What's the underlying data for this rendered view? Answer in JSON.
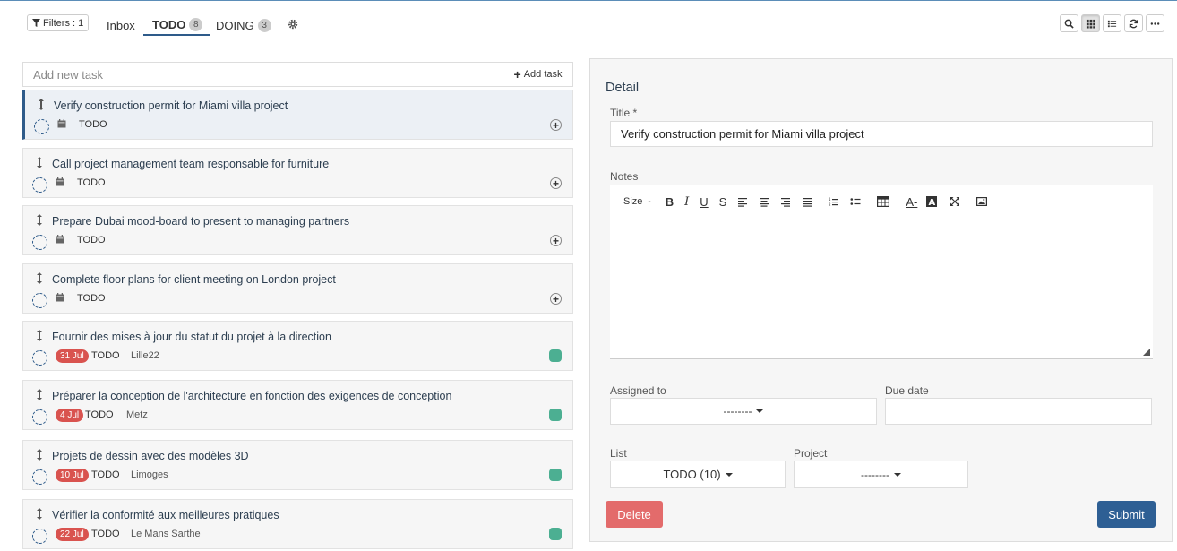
{
  "toolbar": {
    "filter_label": "Filters : 1",
    "tabs": [
      {
        "label": "Inbox",
        "count": null
      },
      {
        "label": "TODO",
        "count": "8"
      },
      {
        "label": "DOING",
        "count": "3"
      }
    ]
  },
  "add_task": {
    "placeholder": "Add new task",
    "button_label": "Add task"
  },
  "tasks": [
    {
      "title": "Verify construction permit for Miami villa project",
      "status": "TODO",
      "date": "",
      "location": ""
    },
    {
      "title": "Call project management team responsable for furniture",
      "status": "TODO",
      "date": "",
      "location": ""
    },
    {
      "title": "Prepare Dubai mood-board to present to managing partners",
      "status": "TODO",
      "date": "",
      "location": ""
    },
    {
      "title": "Complete floor plans for client meeting on London project",
      "status": "TODO",
      "date": "",
      "location": ""
    },
    {
      "title": "Fournir des mises à jour du statut du projet à la direction",
      "status": "TODO",
      "date": "31 Jul",
      "location": "Lille22"
    },
    {
      "title": "Préparer la conception de l'architecture en fonction des exigences de conception",
      "status": "TODO",
      "date": "4 Jul",
      "location": "Metz"
    },
    {
      "title": "Projets de dessin avec des modèles 3D",
      "status": "TODO",
      "date": "10 Jul",
      "location": "Limoges"
    },
    {
      "title": "Vérifier la conformité aux meilleures pratiques",
      "status": "TODO",
      "date": "22 Jul",
      "location": "Le Mans Sarthe"
    }
  ],
  "detail": {
    "heading": "Detail",
    "title_label": "Title *",
    "title_value": "Verify construction permit for Miami villa project",
    "notes_label": "Notes",
    "editor_size_label": "Size",
    "assigned_label": "Assigned to",
    "assigned_value": "--------",
    "due_label": "Due date",
    "due_value": "",
    "list_label": "List",
    "list_value": "TODO (10)",
    "project_label": "Project",
    "project_value": "--------",
    "delete_label": "Delete",
    "submit_label": "Submit"
  },
  "colors": {
    "accent": "#2e5b8a",
    "delete": "#e36b6b",
    "submit": "#2e5f94",
    "date_badge": "#d9534f",
    "tag_green": "#4caf92"
  }
}
